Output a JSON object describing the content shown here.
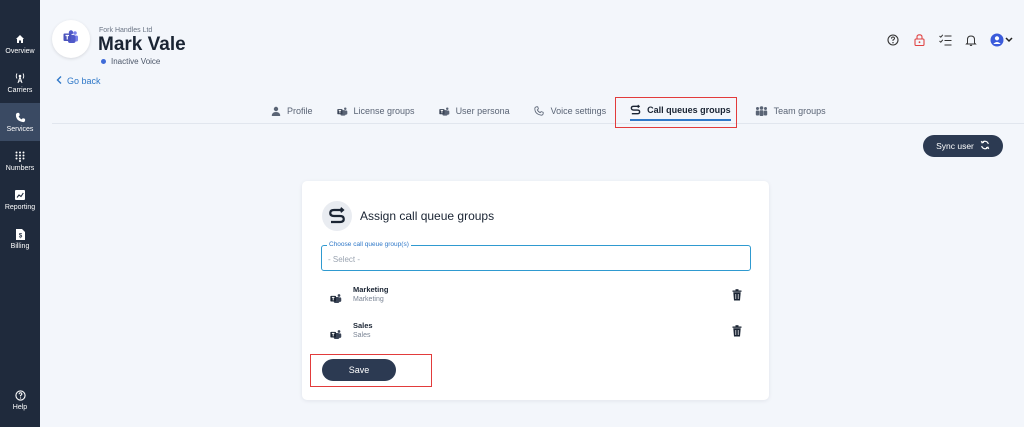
{
  "sidebar": {
    "items": [
      {
        "label": "Overview",
        "icon": "home-icon"
      },
      {
        "label": "Carriers",
        "icon": "antenna-icon"
      },
      {
        "label": "Services",
        "icon": "phone-icon",
        "active": true
      },
      {
        "label": "Numbers",
        "icon": "keypad-icon"
      },
      {
        "label": "Reporting",
        "icon": "chart-icon"
      },
      {
        "label": "Billing",
        "icon": "invoice-icon"
      }
    ],
    "help_label": "Help"
  },
  "header": {
    "company": "Fork Handles Ltd",
    "user_name": "Mark Vale",
    "status": "Inactive Voice",
    "go_back": "Go back"
  },
  "top_icons": [
    "help-icon",
    "lock-icon",
    "checklist-icon",
    "bell-icon",
    "user-avatar-icon"
  ],
  "tabs": [
    {
      "label": "Profile",
      "icon": "person-icon"
    },
    {
      "label": "License groups",
      "icon": "teams-icon"
    },
    {
      "label": "User persona",
      "icon": "teams-icon"
    },
    {
      "label": "Voice settings",
      "icon": "phone-icon"
    },
    {
      "label": "Call queues groups",
      "icon": "call-queue-icon",
      "active": true
    },
    {
      "label": "Team groups",
      "icon": "team-icon"
    }
  ],
  "sync_button": "Sync user",
  "card": {
    "title": "Assign call queue groups",
    "select_legend": "Choose call queue group(s)",
    "select_placeholder": "- Select -",
    "groups": [
      {
        "name": "Marketing",
        "sub": "Marketing"
      },
      {
        "name": "Sales",
        "sub": "Sales"
      }
    ],
    "save_label": "Save"
  },
  "colors": {
    "sidebar_bg": "#1f2a3c",
    "accent": "#2f78c8",
    "button_bg": "#2c3a52",
    "highlight": "#e23b3b",
    "page_bg": "#f3f6fb"
  }
}
